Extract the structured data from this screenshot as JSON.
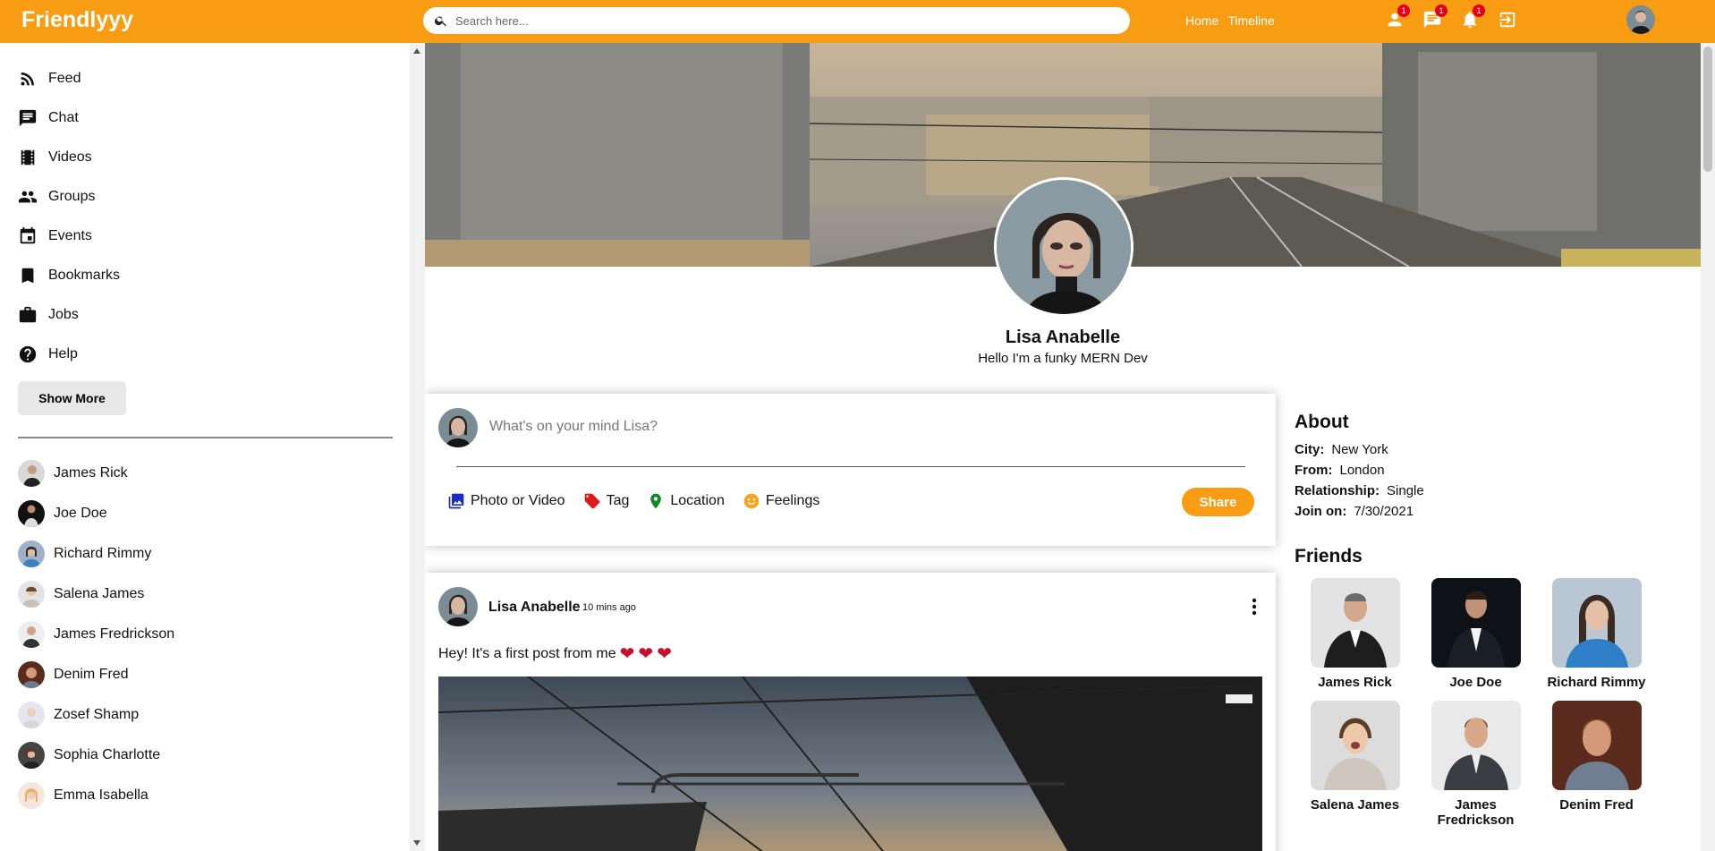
{
  "app": {
    "logo": "Friendlyyy"
  },
  "search": {
    "placeholder": "Search here..."
  },
  "topnav": {
    "home": "Home",
    "timeline": "Timeline"
  },
  "notifications": {
    "friend_requests": "1",
    "messages": "1",
    "alerts": "1"
  },
  "sidebar": {
    "items": [
      {
        "label": "Feed",
        "icon": "rss-feed-icon"
      },
      {
        "label": "Chat",
        "icon": "chat-icon"
      },
      {
        "label": "Videos",
        "icon": "video-icon"
      },
      {
        "label": "Groups",
        "icon": "groups-icon"
      },
      {
        "label": "Events",
        "icon": "event-icon"
      },
      {
        "label": "Bookmarks",
        "icon": "bookmark-icon"
      },
      {
        "label": "Jobs",
        "icon": "work-icon"
      },
      {
        "label": "Help",
        "icon": "help-icon"
      }
    ],
    "show_more": "Show More",
    "friends": [
      "James Rick",
      "Joe Doe",
      "Richard Rimmy",
      "Salena James",
      "James Fredrickson",
      "Denim Fred",
      "Zosef Shamp",
      "Sophia Charlotte",
      "Emma Isabella"
    ]
  },
  "profile": {
    "name": "Lisa Anabelle",
    "description": "Hello I'm a funky MERN Dev"
  },
  "share": {
    "placeholder": "What's on your mind Lisa?",
    "options": [
      "Photo or Video",
      "Tag",
      "Location",
      "Feelings"
    ],
    "button": "Share"
  },
  "post": {
    "author": "Lisa Anabelle",
    "time": "10 mins ago",
    "text": "Hey! It's a first post from me"
  },
  "about": {
    "title": "About",
    "rows": [
      {
        "key": "City:",
        "value": "New York"
      },
      {
        "key": "From:",
        "value": "London"
      },
      {
        "key": "Relationship:",
        "value": "Single"
      },
      {
        "key": "Join on:",
        "value": "7/30/2021"
      }
    ]
  },
  "friends_panel": {
    "title": "Friends",
    "list": [
      "James Rick",
      "Joe Doe",
      "Richard Rimmy",
      "Salena James",
      "James Fredrickson",
      "Denim Fred"
    ]
  },
  "colors": {
    "brand": "#f89d13",
    "badge": "#e5001a"
  }
}
